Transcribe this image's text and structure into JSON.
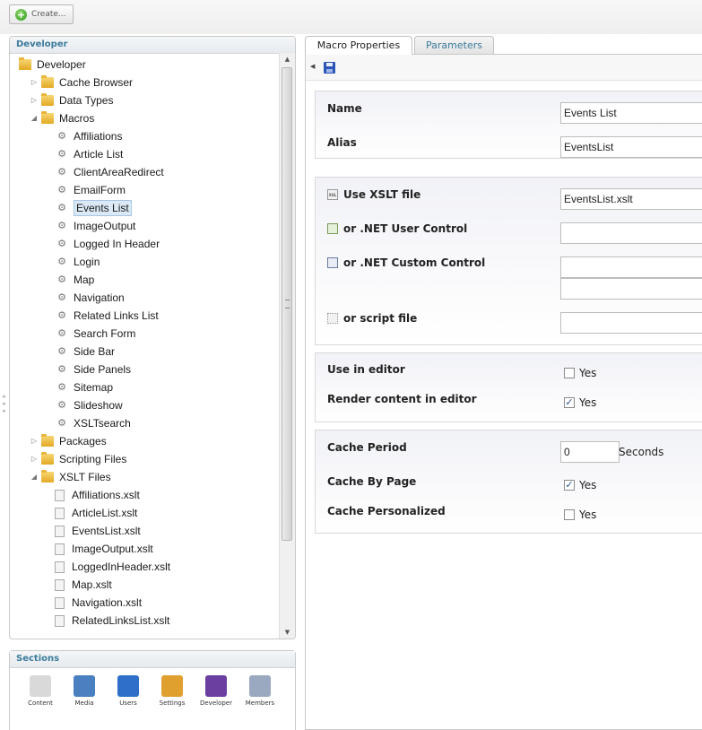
{
  "toolbar": {
    "create_label": "Create..."
  },
  "tree_panel": {
    "title": "Developer",
    "rows": [
      {
        "label": "Developer",
        "type": "folder",
        "level": 0,
        "expander": ""
      },
      {
        "label": "Cache Browser",
        "type": "folder",
        "level": 1,
        "expander": "collapsed"
      },
      {
        "label": "Data Types",
        "type": "folder",
        "level": 1,
        "expander": "collapsed"
      },
      {
        "label": "Macros",
        "type": "folder",
        "level": 1,
        "expander": "expanded"
      },
      {
        "label": "Affiliations",
        "type": "macro",
        "level": 2
      },
      {
        "label": "Article List",
        "type": "macro",
        "level": 2
      },
      {
        "label": "ClientAreaRedirect",
        "type": "macro",
        "level": 2
      },
      {
        "label": "EmailForm",
        "type": "macro",
        "level": 2
      },
      {
        "label": "Events List",
        "type": "macro",
        "level": 2,
        "selected": true
      },
      {
        "label": "ImageOutput",
        "type": "macro",
        "level": 2
      },
      {
        "label": "Logged In Header",
        "type": "macro",
        "level": 2
      },
      {
        "label": "Login",
        "type": "macro",
        "level": 2
      },
      {
        "label": "Map",
        "type": "macro",
        "level": 2
      },
      {
        "label": "Navigation",
        "type": "macro",
        "level": 2
      },
      {
        "label": "Related Links List",
        "type": "macro",
        "level": 2
      },
      {
        "label": "Search Form",
        "type": "macro",
        "level": 2
      },
      {
        "label": "Side Bar",
        "type": "macro",
        "level": 2
      },
      {
        "label": "Side Panels",
        "type": "macro",
        "level": 2
      },
      {
        "label": "Sitemap",
        "type": "macro",
        "level": 2
      },
      {
        "label": "Slideshow",
        "type": "macro",
        "level": 2
      },
      {
        "label": "XSLTsearch",
        "type": "macro",
        "level": 2
      },
      {
        "label": "Packages",
        "type": "folder",
        "level": 1,
        "expander": "collapsed"
      },
      {
        "label": "Scripting Files",
        "type": "folder",
        "level": 1,
        "expander": "collapsed"
      },
      {
        "label": "XSLT Files",
        "type": "folder",
        "level": 1,
        "expander": "expanded"
      },
      {
        "label": "Affiliations.xslt",
        "type": "xslt",
        "level": 2
      },
      {
        "label": "ArticleList.xslt",
        "type": "xslt",
        "level": 2
      },
      {
        "label": "EventsList.xslt",
        "type": "xslt",
        "level": 2
      },
      {
        "label": "ImageOutput.xslt",
        "type": "xslt",
        "level": 2
      },
      {
        "label": "LoggedInHeader.xslt",
        "type": "xslt",
        "level": 2
      },
      {
        "label": "Map.xslt",
        "type": "xslt",
        "level": 2
      },
      {
        "label": "Navigation.xslt",
        "type": "xslt",
        "level": 2
      },
      {
        "label": "RelatedLinksList.xslt",
        "type": "xslt",
        "level": 2
      }
    ]
  },
  "sections": {
    "title": "Sections",
    "items": [
      {
        "label": "Content",
        "icon": "content-icon",
        "color": "#d9d9d9"
      },
      {
        "label": "Media",
        "icon": "media-icon",
        "color": "#4a7fc0"
      },
      {
        "label": "Users",
        "icon": "users-icon",
        "color": "#2f6fc9"
      },
      {
        "label": "Settings",
        "icon": "settings-icon",
        "color": "#e0a030"
      },
      {
        "label": "Developer",
        "icon": "developer-icon",
        "color": "#6a3fa0"
      },
      {
        "label": "Members",
        "icon": "members-icon",
        "color": "#9aa8c0"
      }
    ]
  },
  "tabs": [
    {
      "label": "Macro Properties",
      "active": true
    },
    {
      "label": "Parameters",
      "active": false
    }
  ],
  "properties": {
    "name": {
      "label": "Name",
      "value": "Events List"
    },
    "alias": {
      "label": "Alias",
      "value": "EventsList"
    },
    "xslt": {
      "label": "Use XSLT file",
      "value": "EventsList.xslt",
      "icon_text": "XSL"
    },
    "user_control": {
      "label": "or .NET User Control",
      "value": ""
    },
    "custom_control": {
      "label": "or .NET Custom Control",
      "value1": "",
      "value2": ""
    },
    "script": {
      "label": "or script file",
      "value": ""
    },
    "use_in_editor": {
      "label": "Use in editor",
      "option": "Yes",
      "checked": false
    },
    "render_content": {
      "label": "Render content in editor",
      "option": "Yes",
      "checked": true
    },
    "cache_period": {
      "label": "Cache Period",
      "value": "0",
      "unit": "Seconds"
    },
    "cache_by_page": {
      "label": "Cache By Page",
      "option": "Yes",
      "checked": true
    },
    "cache_personalized": {
      "label": "Cache Personalized",
      "option": "Yes",
      "checked": false
    }
  }
}
